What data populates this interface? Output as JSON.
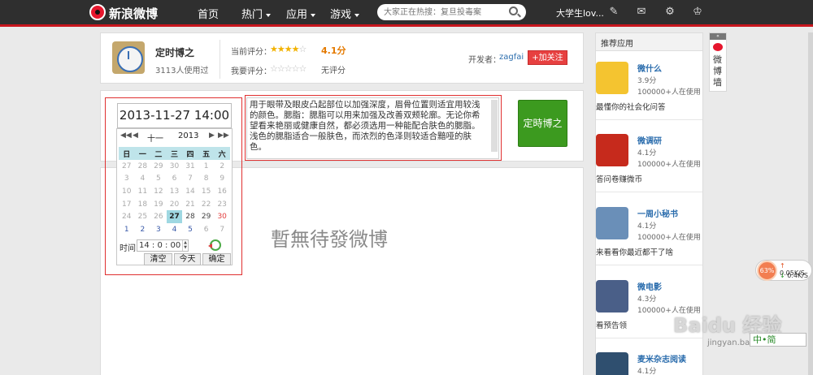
{
  "topbar": {
    "logo_text": "新浪微博",
    "nav": [
      {
        "label": "首页"
      },
      {
        "label": "热门"
      },
      {
        "label": "应用"
      },
      {
        "label": "游戏"
      }
    ],
    "search_placeholder": "大家正在热搜：复旦投毒案",
    "username": "大学生lov...",
    "icons": [
      "edit-icon",
      "mail-icon",
      "gear-icon",
      "crown-icon"
    ]
  },
  "app": {
    "name": "定时博之",
    "users": "3113人使用过",
    "current_rating_label": "当前评分：",
    "current_rating_stars": 4,
    "current_score": "4.1分",
    "my_rating_label": "我要评分：",
    "no_score": "无评分",
    "developer_label": "开发者：",
    "developer": "zagfai",
    "follow_button": "+加关注"
  },
  "datetime": {
    "value": "2013-11-27 14:00"
  },
  "calendar": {
    "month": "十一",
    "year": "2013",
    "weekdays": [
      "日",
      "一",
      "二",
      "三",
      "四",
      "五",
      "六"
    ],
    "weeks": [
      [
        "27",
        "28",
        "29",
        "30",
        "31",
        "1",
        "2"
      ],
      [
        "3",
        "4",
        "5",
        "6",
        "7",
        "8",
        "9"
      ],
      [
        "10",
        "11",
        "12",
        "13",
        "14",
        "15",
        "16"
      ],
      [
        "17",
        "18",
        "19",
        "20",
        "21",
        "22",
        "23"
      ],
      [
        "24",
        "25",
        "26",
        "27",
        "28",
        "29",
        "30"
      ],
      [
        "1",
        "2",
        "3",
        "4",
        "5",
        "6",
        "7"
      ]
    ],
    "selected": "27",
    "time_label": "时间",
    "time_value": "14 : 0 : 00",
    "buttons": {
      "clear": "清空",
      "today": "今天",
      "ok": "确定"
    }
  },
  "editor": {
    "text": "用于眼带及眼皮凸起部位以加强深度，眉骨位置则适宜用较浅的颜色。腮脂：腮脂可以用来加强及改善双颊轮廓。无论你希望看来艳丽或健康自然，都必须选用一种能配合肤色的腮脂。浅色的腮脂适合一般肤色，而浓烈的色泽则较适合黯哑的肤色。",
    "submit_button": "定時博之"
  },
  "main": {
    "empty_message": "暫無待發微博"
  },
  "sidebar": {
    "title": "推荐应用",
    "items": [
      {
        "name": "微什么",
        "rating": "3.9分",
        "users": "100000+人在使用",
        "desc": "最懂你的社会化问答",
        "thumb_color": "#f4c430"
      },
      {
        "name": "微调研",
        "rating": "4.1分",
        "users": "100000+人在使用",
        "desc": "答问卷赚微币",
        "thumb_color": "#c62a1c"
      },
      {
        "name": "一周小秘书",
        "rating": "4.1分",
        "users": "100000+人在使用",
        "desc": "来看看你最近都干了啥",
        "thumb_color": "#6a8fb8"
      },
      {
        "name": "微电影",
        "rating": "4.3分",
        "users": "100000+人在使用",
        "desc": "看预告领",
        "thumb_color": "#4a5f88"
      },
      {
        "name": "麦米杂志阅读",
        "rating": "4.1分",
        "users": "",
        "desc": "",
        "thumb_color": "#2f4f6f"
      }
    ]
  },
  "wall": {
    "collapse_label": "«",
    "label": "微博墙"
  },
  "netmeter": {
    "percent": "63%",
    "up": "0.05K/S",
    "down": "0.4K/S"
  },
  "ime": {
    "label": "中•简"
  },
  "watermark": {
    "text": "Baidu 经验",
    "url": "jingyan.baidu.com"
  }
}
